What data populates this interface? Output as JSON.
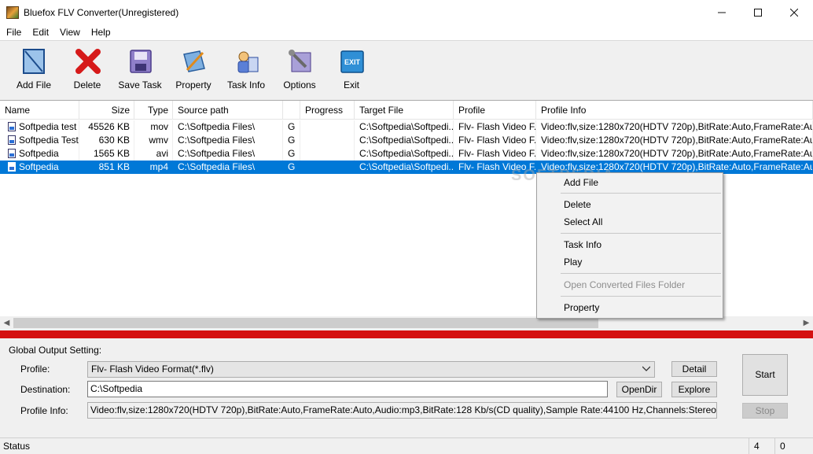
{
  "window": {
    "title": "Bluefox FLV Converter(Unregistered)"
  },
  "menu": [
    "File",
    "Edit",
    "View",
    "Help"
  ],
  "toolbar": [
    {
      "label": "Add File",
      "icon": "add-file-icon"
    },
    {
      "label": "Delete",
      "icon": "delete-icon"
    },
    {
      "label": "Save Task",
      "icon": "save-icon"
    },
    {
      "label": "Property",
      "icon": "property-icon"
    },
    {
      "label": "Task Info",
      "icon": "task-info-icon"
    },
    {
      "label": "Options",
      "icon": "options-icon"
    },
    {
      "label": "Exit",
      "icon": "exit-icon"
    }
  ],
  "columns": [
    "Name",
    "Size",
    "Type",
    "Source path",
    "",
    "Progress",
    "Target File",
    "Profile",
    "Profile Info"
  ],
  "rows": [
    {
      "name": "Softpedia test",
      "size": "45526 KB",
      "type": "mov",
      "source": "C:\\Softpedia Files\\",
      "g": "G",
      "progress": "",
      "target": "C:\\Softpedia\\Softpedi...",
      "profile": "Flv- Flash Video F...",
      "info": "Video:flv,size:1280x720(HDTV 720p),BitRate:Auto,FrameRate:Auto,Audi",
      "selected": false
    },
    {
      "name": "Softpedia Test",
      "size": "630 KB",
      "type": "wmv",
      "source": "C:\\Softpedia Files\\",
      "g": "G",
      "progress": "",
      "target": "C:\\Softpedia\\Softpedi...",
      "profile": "Flv- Flash Video F...",
      "info": "Video:flv,size:1280x720(HDTV 720p),BitRate:Auto,FrameRate:Auto,Audi",
      "selected": false
    },
    {
      "name": "Softpedia",
      "size": "1565 KB",
      "type": "avi",
      "source": "C:\\Softpedia Files\\",
      "g": "G",
      "progress": "",
      "target": "C:\\Softpedia\\Softpedi...",
      "profile": "Flv- Flash Video F...",
      "info": "Video:flv,size:1280x720(HDTV 720p),BitRate:Auto,FrameRate:Auto,Audi",
      "selected": false
    },
    {
      "name": "Softpedia",
      "size": "851 KB",
      "type": "mp4",
      "source": "C:\\Softpedia Files\\",
      "g": "G",
      "progress": "",
      "target": "C:\\Softpedia\\Softpedi...",
      "profile": "Flv- Flash Video F...",
      "info": "Video:flv,size:1280x720(HDTV 720p),BitRate:Auto,FrameRate:Auto,Audi",
      "selected": true
    }
  ],
  "context_menu": [
    {
      "label": "Add File",
      "disabled": false
    },
    {
      "label": "Delete",
      "disabled": false
    },
    {
      "label": "Select All",
      "disabled": false
    },
    {
      "label": "Task Info",
      "disabled": false
    },
    {
      "label": "Play",
      "disabled": false
    },
    {
      "label": "Open Converted Files Folder",
      "disabled": true
    },
    {
      "label": "Property",
      "disabled": false
    }
  ],
  "watermark": "SOFTPEDIA",
  "settings": {
    "heading": "Global Output Setting:",
    "profile_label": "Profile:",
    "profile_value": "Flv- Flash Video Format(*.flv)",
    "destination_label": "Destination:",
    "destination_value": "C:\\Softpedia",
    "profile_info_label": "Profile Info:",
    "profile_info_value": "Video:flv,size:1280x720(HDTV 720p),BitRate:Auto,FrameRate:Auto,Audio:mp3,BitRate:128 Kb/s(CD quality),Sample Rate:44100 Hz,Channels:Stereo",
    "detail_btn": "Detail",
    "opendir_btn": "OpenDir",
    "explore_btn": "Explore",
    "start_btn": "Start",
    "stop_btn": "Stop"
  },
  "status": {
    "text": "Status",
    "count1": "4",
    "count2": "0"
  },
  "colors": {
    "selection": "#0078d7",
    "accent_red": "#d41111"
  }
}
